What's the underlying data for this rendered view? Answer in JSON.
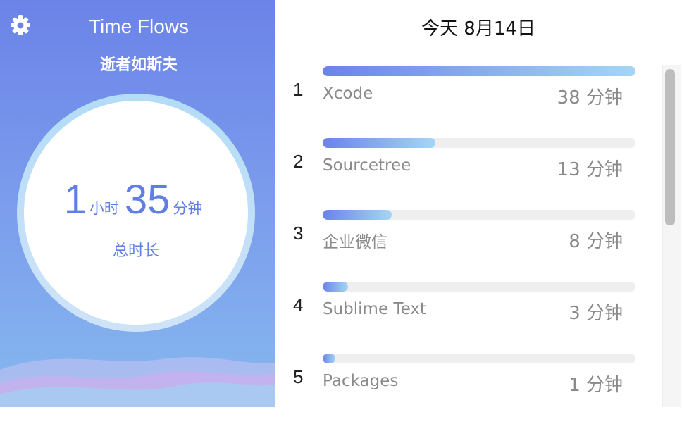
{
  "header": {
    "title": "Time Flows",
    "subtitle": "逝者如斯夫",
    "settings_icon": "gear-icon"
  },
  "summary": {
    "hours": "1",
    "hours_unit": "小时",
    "minutes": "35",
    "minutes_unit": "分钟",
    "label": "总时长"
  },
  "list": {
    "date": "今天 8月14日",
    "items": [
      {
        "rank": "1",
        "name": "Xcode",
        "duration": "38 分钟",
        "fraction": 1.0
      },
      {
        "rank": "2",
        "name": "Sourcetree",
        "duration": "13 分钟",
        "fraction": 0.36
      },
      {
        "rank": "3",
        "name": "企业微信",
        "duration": "8 分钟",
        "fraction": 0.22
      },
      {
        "rank": "4",
        "name": "Sublime Text",
        "duration": "3 分钟",
        "fraction": 0.08
      },
      {
        "rank": "5",
        "name": "Packages",
        "duration": "1 分钟",
        "fraction": 0.04
      }
    ]
  },
  "colors": {
    "accent": "#5f7fe3",
    "gradient_start": "#6b83e8",
    "gradient_end": "#a4d6f6",
    "track": "#efefef",
    "muted_text": "#8a8a8a"
  }
}
